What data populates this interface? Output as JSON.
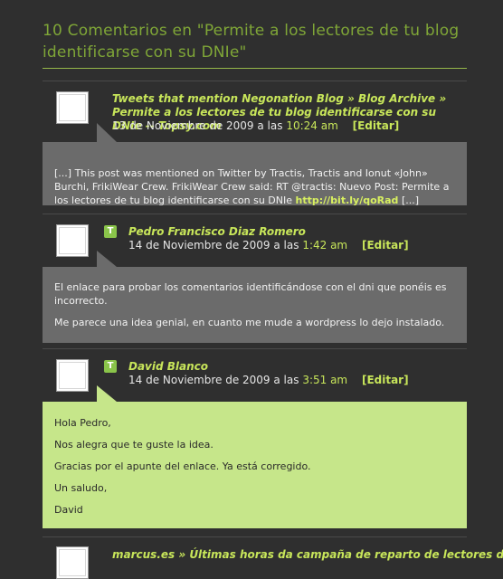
{
  "heading": "10 Comentarios en \"Permite a los lectores de tu blog identificarse con su DNIe\"",
  "comments": [
    {
      "author": "Tweets that mention Negonation Blog » Blog Archive » Permite a los lectores de tu blog identificarse con su DNIe -- Topsy.com",
      "date": "13 de Noviembre de 2009 a las",
      "time": "10:24 am",
      "edit": "[Editar]",
      "body_text": "[...] This post was mentioned on Twitter by Tractis, Tractis and Ionut «John» Burchi, FrikiWear Crew. FrikiWear Crew said: RT @tractis: Nuevo Post: Permite a los lectores de tu blog identificarse con su DNIe",
      "body_link": "http://bit.ly/qoRad",
      "body_end": "[...]"
    },
    {
      "author": "Pedro Francisco Diaz Romero",
      "badge": "T",
      "date": "14 de Noviembre de 2009 a las",
      "time": "1:42 am",
      "edit": "[Editar]",
      "paragraphs": [
        "El enlace para probar los comentarios identificándose con el dni que ponéis es incorrecto.",
        "Me parece una idea genial, en cuanto me mude a wordpress lo dejo instalado."
      ]
    },
    {
      "author": "David Blanco",
      "badge": "T",
      "date": "14 de Noviembre de 2009 a las",
      "time": "3:51 am",
      "edit": "[Editar]",
      "paragraphs": [
        "Hola Pedro,",
        "Nos alegra que te guste la idea.",
        "Gracias por el apunte del enlace. Ya está corregido.",
        "Un saludo,",
        "David"
      ]
    },
    {
      "author": "marcus.es » Últimas horas da campaña de reparto de lectores de"
    }
  ],
  "colors": {
    "background": "#2f2f2f",
    "accent": "#c8e65a",
    "heading": "#7fa637",
    "gray_box": "#6b6b6b",
    "green_box": "#c6e68a"
  }
}
